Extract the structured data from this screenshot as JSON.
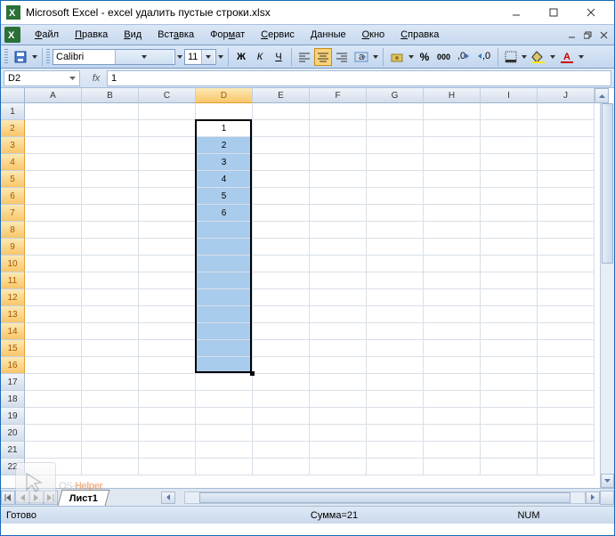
{
  "window": {
    "title": "Microsoft Excel - excel удалить пустые строки.xlsx"
  },
  "menu": {
    "file": "Файл",
    "edit": "Правка",
    "view": "Вид",
    "insert": "Вставка",
    "format": "Формат",
    "service": "Сервис",
    "data": "Данные",
    "window": "Окно",
    "help": "Справка"
  },
  "toolbar": {
    "font": "Calibri",
    "font_size": "11",
    "bold": "Ж",
    "italic": "К",
    "underline": "Ч"
  },
  "formula_bar": {
    "name_box": "D2",
    "fx": "fx",
    "value": "1"
  },
  "columns": [
    "A",
    "B",
    "C",
    "D",
    "E",
    "F",
    "G",
    "H",
    "I",
    "J"
  ],
  "rows_count": 22,
  "selected_col_index": 3,
  "selected_rows_start": 2,
  "selected_rows_end": 16,
  "cells": {
    "D2": "1",
    "D3": "2",
    "D4": "3",
    "D5": "4",
    "D6": "5",
    "D7": "6"
  },
  "chart_data": {
    "type": "table",
    "columns": [
      "D"
    ],
    "rows": [
      {
        "row": 2,
        "D": 1
      },
      {
        "row": 3,
        "D": 2
      },
      {
        "row": 4,
        "D": 3
      },
      {
        "row": 5,
        "D": 4
      },
      {
        "row": 6,
        "D": 5
      },
      {
        "row": 7,
        "D": 6
      }
    ]
  },
  "sheet": {
    "name": "Лист1"
  },
  "status": {
    "ready": "Готово",
    "sum": "Сумма=21",
    "num": "NUM"
  },
  "watermark": {
    "os": "OS-",
    "helper": "Helper"
  }
}
